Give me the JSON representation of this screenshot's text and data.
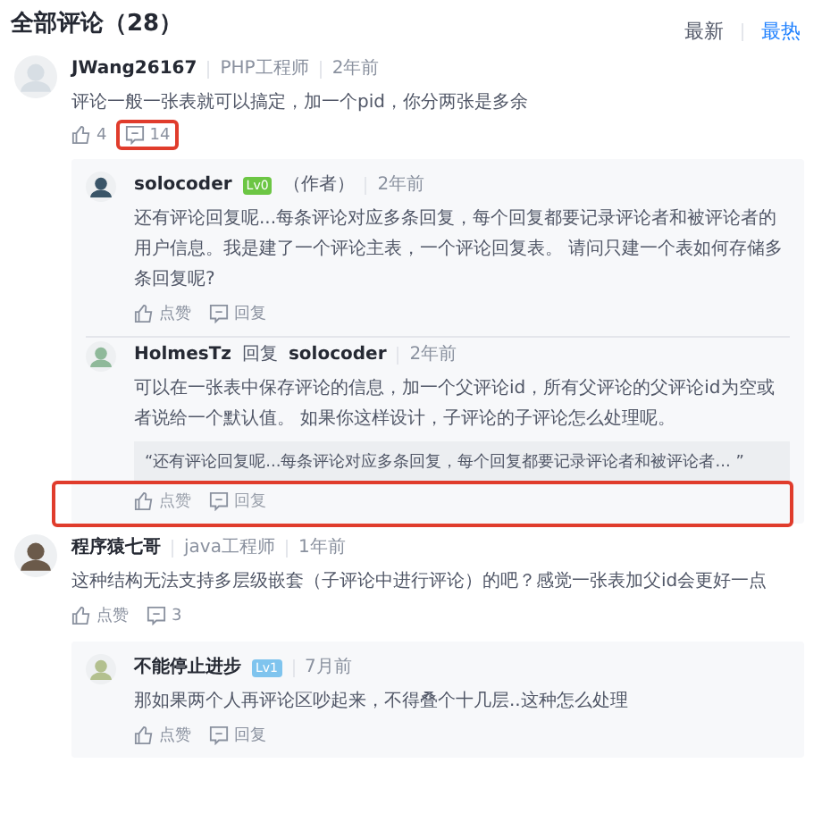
{
  "header": {
    "title": "全部评论（28）",
    "sort_options": [
      {
        "label": "最新",
        "selected": false
      },
      {
        "label": "最热",
        "selected": true
      }
    ]
  },
  "comments": [
    {
      "author": "JWang26167",
      "role": "PHP工程师",
      "time": "2年前",
      "text": "评论一般一张表就可以搞定，加一个pid，你分两张是多余",
      "like": "4",
      "reply_count": "14",
      "reply_count_highlighted": true,
      "replies": [
        {
          "author": "solocoder",
          "badge": "Lv0",
          "color": "#6cc644",
          "author_tag": "（作者）",
          "time": "2年前",
          "text": "还有评论回复呢...每条评论对应多条回复，每个回复都要记录评论者和被评论者的用户信息。我是建了一个评论主表，一个评论回复表。 请问只建一个表如何存储多条回复呢?",
          "like": "点赞",
          "reply": "回复",
          "highlighted": false
        },
        {
          "author": "HolmesTz",
          "reply_word": "回复",
          "reply_to": "solocoder",
          "time": "2年前",
          "text": "可以在一张表中保存评论的信息，加一个父评论id，所有父评论的父评论id为空或者说给一个默认值。 如果你这样设计，子评论的子评论怎么处理呢。",
          "quote": "“还有评论回复呢...每条评论对应多条回复，每个回复都要记录评论者和被评论者... ”",
          "like": "点赞",
          "reply": "回复",
          "highlighted": true
        }
      ]
    },
    {
      "author": "程序猿七哥",
      "role": "java工程师",
      "time": "1年前",
      "text": "这种结构无法支持多层级嵌套（子评论中进行评论）的吧？感觉一张表加父id会更好一点",
      "like": "点赞",
      "reply_count": "3",
      "reply_count_highlighted": false,
      "replies": [
        {
          "author": "不能停止进步",
          "badge": "Lv1",
          "color": "#7fc4ee",
          "time": "7月前",
          "text": "那如果两个人再评论区吵起来，不得叠个十几层..这种怎么处理",
          "like": "点赞",
          "reply": "回复",
          "highlighted": false
        }
      ]
    }
  ]
}
